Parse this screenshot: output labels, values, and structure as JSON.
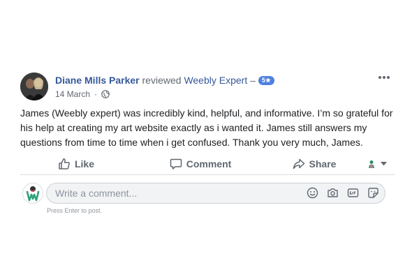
{
  "post": {
    "author_name": "Diane Mills Parker",
    "reviewed_text": "reviewed",
    "page_name": "Weebly Expert",
    "dash": "–",
    "rating_badge": "5★",
    "date": "14 March",
    "dot": "·",
    "body": "James (Weebly expert) was incredibly kind, helpful, and informative. I’m so grateful for his help at creating my art website exactly as i wanted it. James still answers my questions from time to time when i get confused. Thank you very much, James."
  },
  "actions": {
    "like_label": "Like",
    "comment_label": "Comment",
    "share_label": "Share"
  },
  "comment_box": {
    "placeholder": "Write a comment...",
    "hint": "Press Enter to post."
  },
  "colors": {
    "link": "#365899",
    "badge": "#4f7fe0",
    "action_text": "#606770",
    "input_bg": "#f2f3f5"
  },
  "icons": {
    "more": "more-options-icon",
    "globe": "globe-icon",
    "like": "thumbs-up-icon",
    "comment": "speech-bubble-icon",
    "share": "share-arrow-icon",
    "audience": "audience-avatar-icon",
    "caret": "caret-down-icon",
    "emoji": "emoji-icon",
    "camera": "camera-icon",
    "gif": "gif-icon",
    "sticker": "sticker-icon"
  }
}
